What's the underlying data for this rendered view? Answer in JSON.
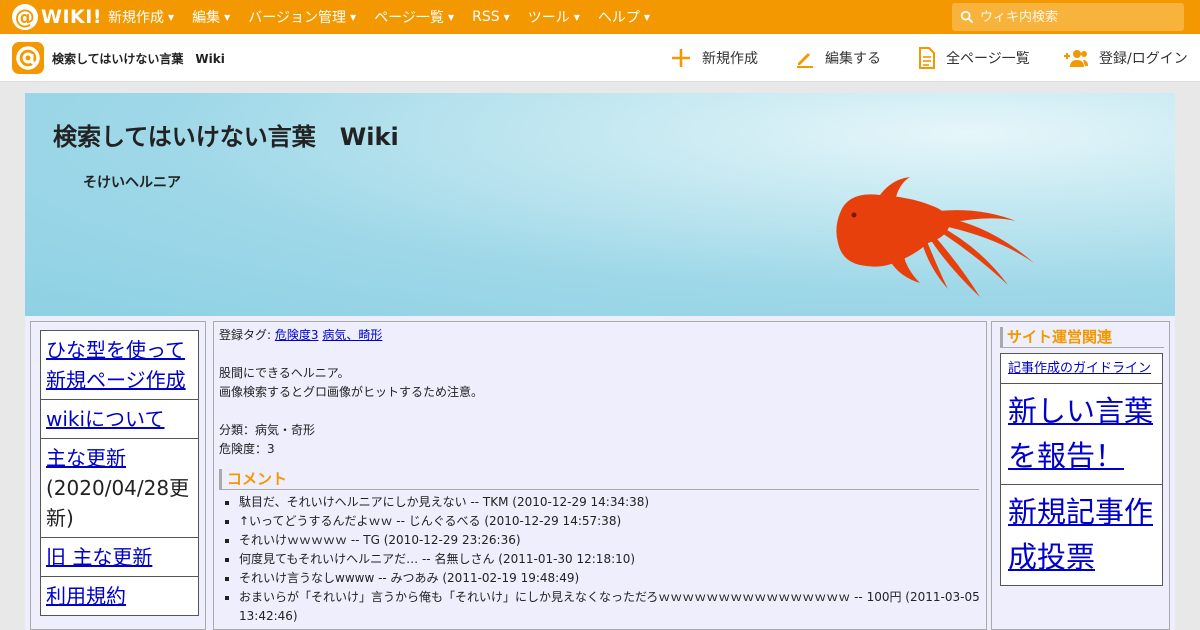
{
  "topbar": {
    "logo_text": "WIKI!",
    "nav": [
      "新規作成",
      "編集",
      "バージョン管理",
      "ページ一覧",
      "RSS",
      "ツール",
      "ヘルプ"
    ],
    "search_placeholder": "ウィキ内検索"
  },
  "subbar": {
    "wiki_name": "検索してはいけない言葉　Wiki",
    "actions": [
      "新規作成",
      "編集する",
      "全ページ一覧",
      "登録/ログイン"
    ]
  },
  "header": {
    "title": "検索してはいけない言葉　Wiki",
    "subtitle": "そけいヘルニア"
  },
  "left_menu": {
    "items": [
      {
        "link": "ひな型を使って新規ページ作成",
        "note": ""
      },
      {
        "link": "wikiについて",
        "note": ""
      },
      {
        "link": "主な更新",
        "note": "(2020/04/28更新)"
      },
      {
        "link": "旧 主な更新",
        "note": ""
      },
      {
        "link": "利用規約",
        "note": ""
      }
    ]
  },
  "content": {
    "tags_label": "登録タグ:",
    "tags": [
      "危険度3",
      "病気、畸形"
    ],
    "desc1": "股間にできるヘルニア。",
    "desc2": "画像検索するとグロ画像がヒットするため注意。",
    "category": "分類：病気・奇形",
    "danger": "危険度：3",
    "comment_heading": "コメント",
    "comments": [
      "駄目だ、それいけヘルニアにしか見えない -- TKM (2010-12-29 14:34:38)",
      "↑いってどうするんだよｗｗ -- じんぐるべる (2010-12-29 14:57:38)",
      "それいけｗｗｗｗｗ -- TG (2010-12-29 23:26:36)",
      "何度見てもそれいけヘルニアだ… -- 名無しさん (2011-01-30 12:18:10)",
      "それいけ言うなしwwww -- みつあみ (2011-02-19 19:48:49)",
      "おまいらが「それいけ」言うから俺も「それいけ」にしか見えなくなっただろｗｗｗｗｗｗｗｗｗｗｗｗｗｗｗｗ -- 100円 (2011-03-05 13:42:46)"
    ]
  },
  "right_menu": {
    "heading": "サイト運営関連",
    "items": [
      "記事作成のガイドライン",
      "新しい言葉を報告！",
      "新規記事作成投票"
    ]
  },
  "colors": {
    "brand_orange": "#f39800",
    "link_blue": "#0000cc",
    "fish": "#e8400c"
  }
}
